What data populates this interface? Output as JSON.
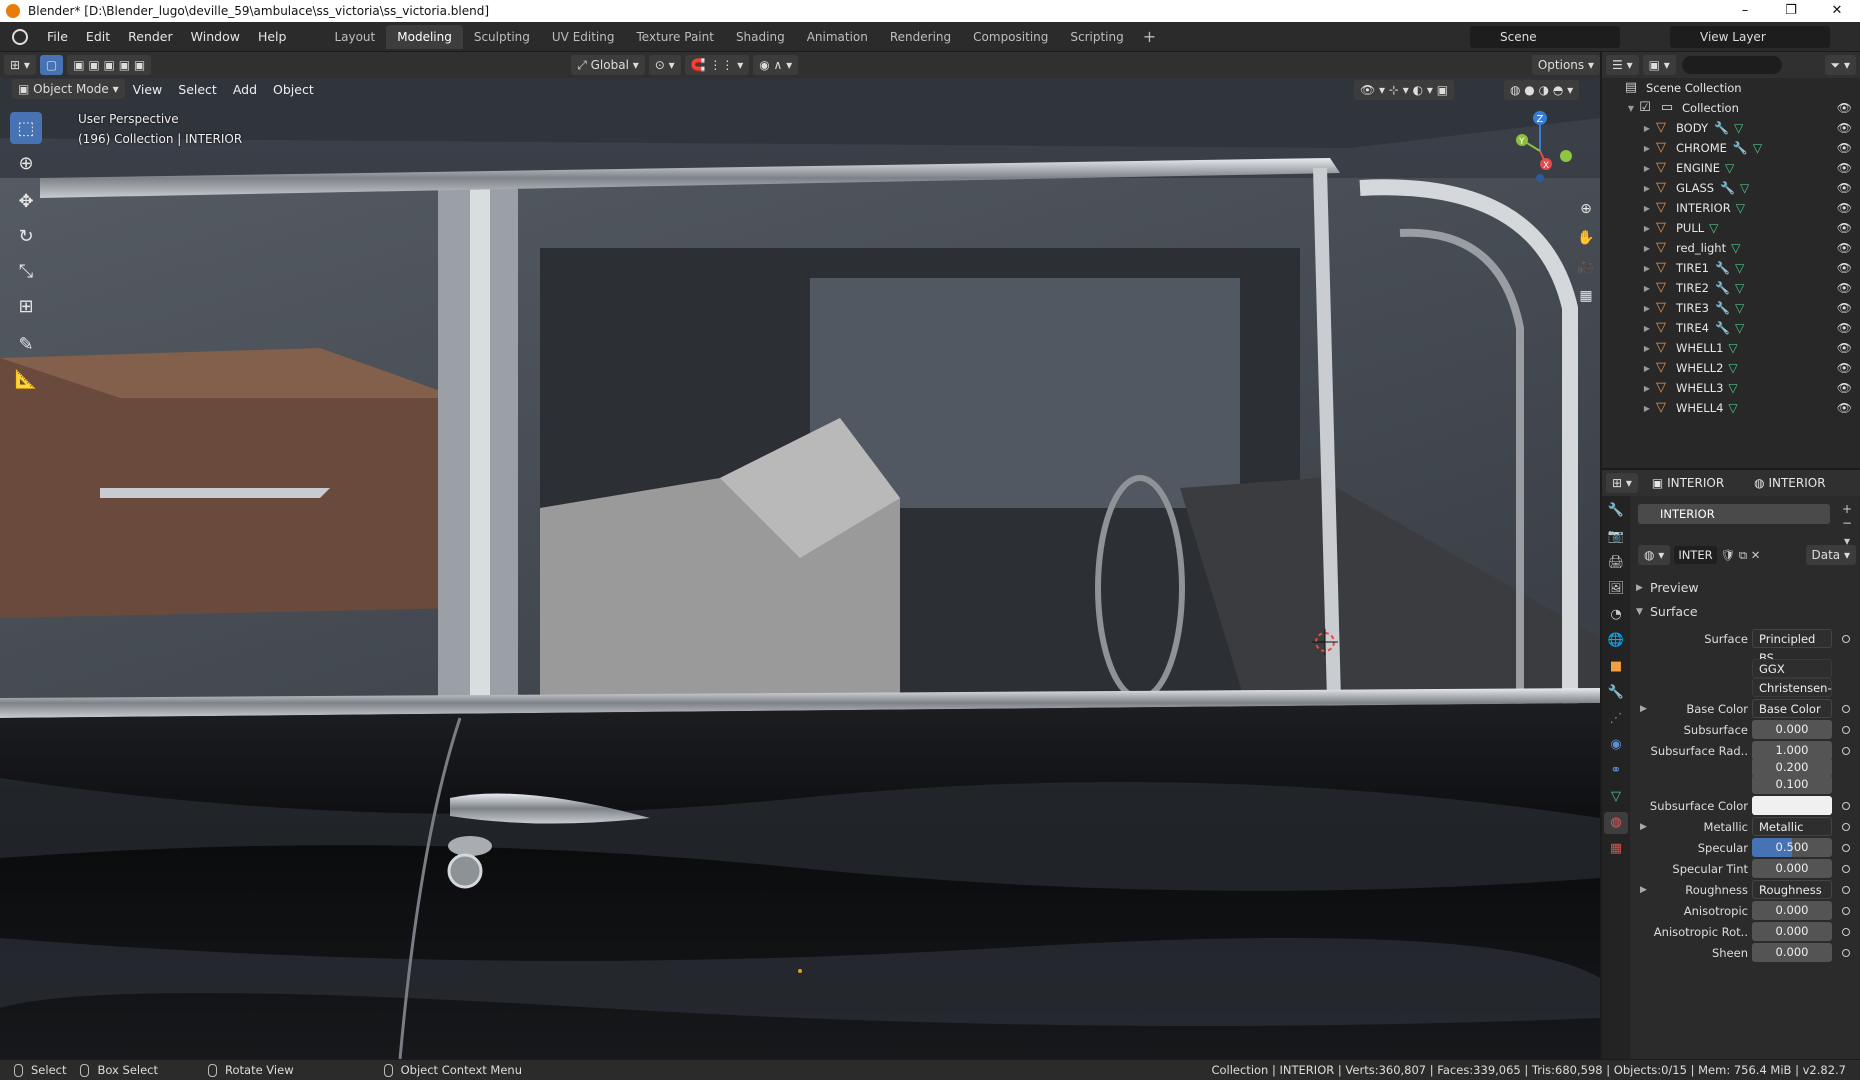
{
  "window": {
    "title": "Blender* [D:\\Blender_lugo\\deville_59\\ambulace\\ss_victoria\\ss_victoria.blend]",
    "controls": [
      "–",
      "❐",
      "✕"
    ]
  },
  "menu": [
    "File",
    "Edit",
    "Render",
    "Window",
    "Help"
  ],
  "workspaces": {
    "tabs": [
      "Layout",
      "Modeling",
      "Sculpting",
      "UV Editing",
      "Texture Paint",
      "Shading",
      "Animation",
      "Rendering",
      "Compositing",
      "Scripting"
    ],
    "active": "Modeling",
    "add": "+"
  },
  "scene": {
    "scene_name": "Scene",
    "view_layer": "View Layer"
  },
  "viewport_header": {
    "transform_orientation": "Global",
    "options_label": "Options"
  },
  "viewport": {
    "mode": "Object Mode",
    "menus": [
      "View",
      "Select",
      "Add",
      "Object"
    ],
    "perspective": "User Perspective",
    "collection_info": "(196) Collection | INTERIOR",
    "gizmo_axes": [
      "Z",
      "Y",
      "X"
    ]
  },
  "outliner": {
    "scene_collection": "Scene Collection",
    "collection": "Collection",
    "objects": [
      {
        "name": "BODY",
        "modifier": true
      },
      {
        "name": "CHROME",
        "modifier": true
      },
      {
        "name": "ENGINE",
        "modifier": false
      },
      {
        "name": "GLASS",
        "modifier": true
      },
      {
        "name": "INTERIOR",
        "modifier": false
      },
      {
        "name": "PULL",
        "modifier": false
      },
      {
        "name": "red_light",
        "modifier": false
      },
      {
        "name": "TIRE1",
        "modifier": true
      },
      {
        "name": "TIRE2",
        "modifier": true
      },
      {
        "name": "TIRE3",
        "modifier": true
      },
      {
        "name": "TIRE4",
        "modifier": true
      },
      {
        "name": "WHELL1",
        "modifier": false
      },
      {
        "name": "WHELL2",
        "modifier": false
      },
      {
        "name": "WHELL3",
        "modifier": false
      },
      {
        "name": "WHELL4",
        "modifier": false
      }
    ]
  },
  "properties": {
    "object_name": "INTERIOR",
    "material_name": "INTERIOR",
    "slot_name": "INTERIOR",
    "material_field": "INTER",
    "link_mode": "Data",
    "panels": {
      "preview": "Preview",
      "surface": "Surface"
    },
    "rows": [
      {
        "label": "Surface",
        "value": "Principled BS..",
        "kind": "link"
      },
      {
        "label": "",
        "value": "GGX",
        "kind": "menu"
      },
      {
        "label": "",
        "value": "Christensen-Bu...",
        "kind": "menu"
      },
      {
        "label": "Base Color",
        "value": "Base Color",
        "kind": "link",
        "expand": true
      },
      {
        "label": "Subsurface",
        "value": "0.000",
        "kind": "num"
      },
      {
        "label": "Subsurface Rad..",
        "value": "1.000",
        "kind": "num"
      },
      {
        "label": "",
        "value": "0.200",
        "kind": "num"
      },
      {
        "label": "",
        "value": "0.100",
        "kind": "num"
      },
      {
        "label": "Subsurface Color",
        "value": "",
        "kind": "color"
      },
      {
        "label": "Metallic",
        "value": "Metallic",
        "kind": "link",
        "expand": true
      },
      {
        "label": "Specular",
        "value": "0.500",
        "kind": "slider"
      },
      {
        "label": "Specular Tint",
        "value": "0.000",
        "kind": "num"
      },
      {
        "label": "Roughness",
        "value": "Roughness",
        "kind": "link",
        "expand": true
      },
      {
        "label": "Anisotropic",
        "value": "0.000",
        "kind": "num"
      },
      {
        "label": "Anisotropic Rot..",
        "value": "0.000",
        "kind": "num"
      },
      {
        "label": "Sheen",
        "value": "0.000",
        "kind": "num"
      }
    ]
  },
  "statusbar": {
    "select": "Select",
    "box_select": "Box Select",
    "rotate_view": "Rotate View",
    "context_menu": "Object Context Menu",
    "stats": "Collection | INTERIOR | Verts:360,807 | Faces:339,065 | Tris:680,598 | Objects:0/15 | Mem: 756.4 MiB | v2.82.7"
  },
  "colors": {
    "accent_blue": "#4772b3",
    "object_orange": "#e8954a",
    "mesh_green": "#4fc48b"
  }
}
